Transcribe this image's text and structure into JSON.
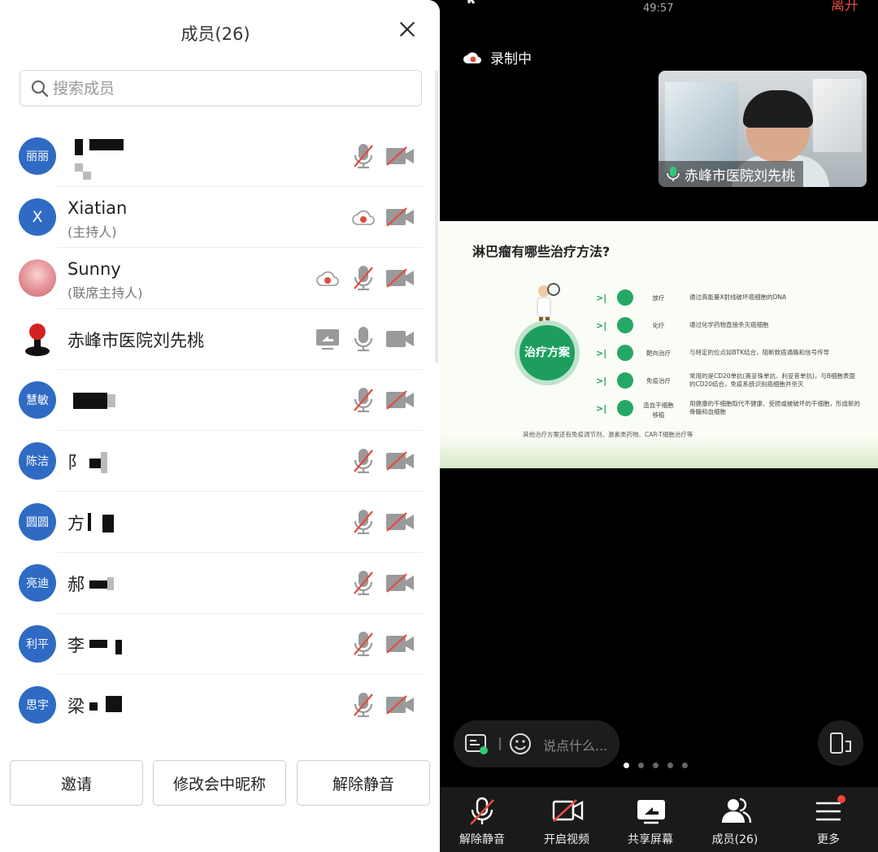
{
  "panel": {
    "title": "成员(26)",
    "search_placeholder": "搜索成员",
    "members": [
      {
        "avatar": "丽丽",
        "name": "",
        "role": ""
      },
      {
        "avatar": "X",
        "name": "Xiatian",
        "role": "(主持人)"
      },
      {
        "avatar": "",
        "name": "Sunny",
        "role": "(联席主持人)"
      },
      {
        "avatar": "",
        "name": "赤峰市医院刘先桃",
        "role": ""
      },
      {
        "avatar": "慧敏",
        "name": "",
        "role": ""
      },
      {
        "avatar": "陈洁",
        "name": "阝",
        "role": ""
      },
      {
        "avatar": "圆圆",
        "name": "方",
        "role": ""
      },
      {
        "avatar": "亮迪",
        "name": "郝",
        "role": ""
      },
      {
        "avatar": "利平",
        "name": "李",
        "role": ""
      },
      {
        "avatar": "思宇",
        "name": "梁",
        "role": ""
      }
    ],
    "buttons": {
      "invite": "邀请",
      "rename": "修改会中昵称",
      "unmute_all": "解除静音"
    }
  },
  "meeting": {
    "timer": "49:57",
    "leave": "离开",
    "recording": "录制中",
    "speaker_label": "赤峰市医院刘先桃",
    "chat_placeholder": "说点什么...",
    "slide": {
      "title": "淋巴瘤有哪些治疗方法?",
      "center": "治疗方案",
      "rows": [
        {
          "t": "放疗",
          "d": "通过高能量X射线破坏癌细胞的DNA"
        },
        {
          "t": "化疗",
          "d": "通过化学药物直接杀灭癌细胞"
        },
        {
          "t": "靶向治疗",
          "d": "与特定的位点如BTK结合，阻断致癌通路和信号传导"
        },
        {
          "t": "免疫治疗",
          "d": "常用的是CD20单抗(奥妥珠单抗、利妥昔单抗)，与B细胞表面的CD20结合，免疫系统识别癌细胞并杀灭"
        },
        {
          "t": "造血干细胞移植",
          "d": "用健康的干细胞取代不健康、受损或被破坏的干细胞，形成新的骨髓和血细胞"
        }
      ],
      "note": "其他治疗方案还有免疫调节剂、激素类药物、CAR-T细胞治疗等"
    },
    "toolbar": [
      {
        "label": "解除静音"
      },
      {
        "label": "开启视频"
      },
      {
        "label": "共享屏幕"
      },
      {
        "label": "成员(26)"
      },
      {
        "label": "更多"
      }
    ]
  }
}
